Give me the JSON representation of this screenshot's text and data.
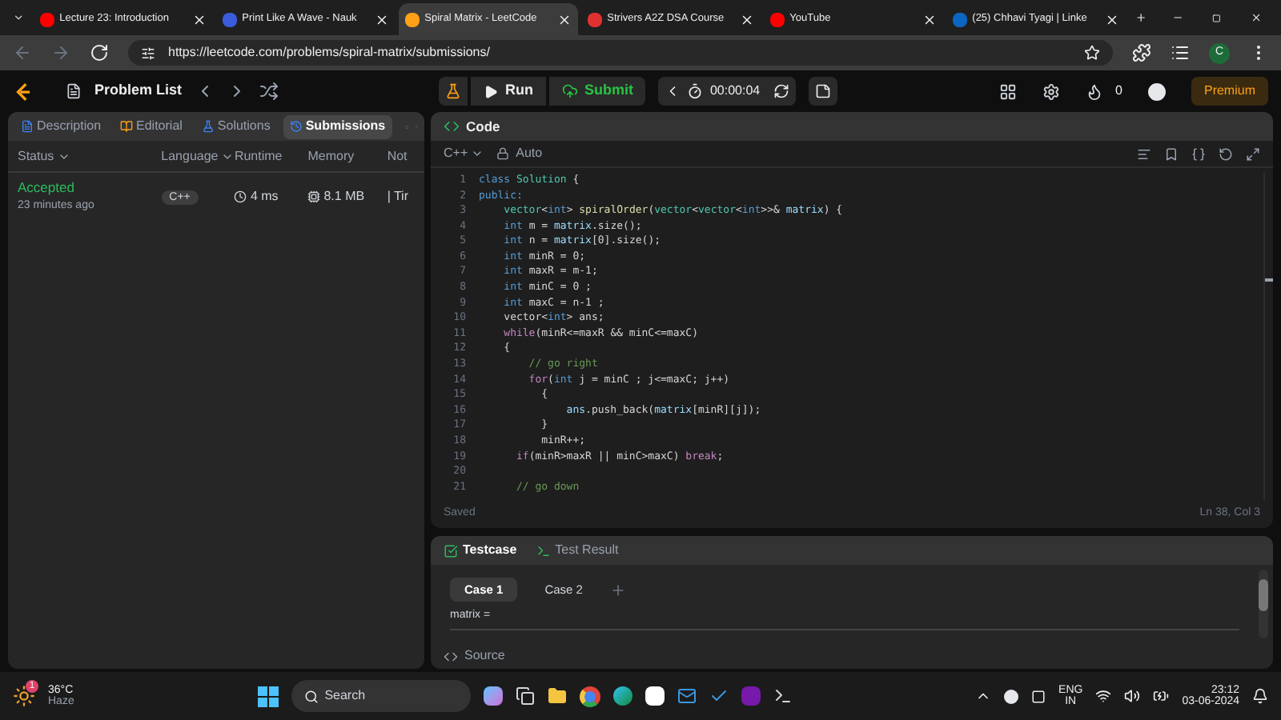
{
  "browser_tabs": [
    {
      "title": "Lecture 23: Introduction",
      "selected": false,
      "kind": "youtube"
    },
    {
      "title": "Print Like A Wave - Nauk",
      "selected": false,
      "kind": "naukri"
    },
    {
      "title": "Spiral Matrix - LeetCode",
      "selected": true,
      "kind": "leetcode"
    },
    {
      "title": "Strivers A2Z DSA Course",
      "selected": false,
      "kind": "tuf"
    },
    {
      "title": "YouTube",
      "selected": false,
      "kind": "youtube"
    },
    {
      "title": "(25) Chhavi Tyagi | Linke",
      "selected": false,
      "kind": "linkedin"
    }
  ],
  "address": "https://leetcode.com/problems/spiral-matrix/submissions/",
  "profile_initial": "C",
  "nav": {
    "problem_list": "Problem List",
    "run": "Run",
    "submit": "Submit",
    "timer": "00:00:04",
    "streak": "0",
    "premium": "Premium"
  },
  "left_tabs": [
    {
      "label": "Description",
      "selected": false
    },
    {
      "label": "Editorial",
      "selected": false
    },
    {
      "label": "Solutions",
      "selected": false
    },
    {
      "label": "Submissions",
      "selected": true
    }
  ],
  "columns": [
    "Status",
    "Language",
    "Runtime",
    "Memory",
    "Not"
  ],
  "submissions": [
    {
      "status": "Accepted",
      "time": "23 minutes ago",
      "language": "C++",
      "runtime": "4 ms",
      "memory": "8.1 MB",
      "column_5": "| Tir"
    }
  ],
  "code_panel": {
    "title": "Code",
    "language": "C++",
    "mode": "Auto",
    "saved": "Saved",
    "cursor": "Ln 38, Col 3"
  },
  "code_lines": [
    {
      "number": "1",
      "tokens": [
        {
          "kind": "keyword",
          "text": "class"
        },
        {
          "kind": "type",
          "text": " Solution"
        },
        {
          "kind": "plain",
          "text": " {"
        }
      ]
    },
    {
      "number": "2",
      "tokens": [
        {
          "kind": "keyword",
          "text": "public:"
        }
      ]
    },
    {
      "number": "3",
      "tokens": [
        {
          "kind": "type",
          "text": "    vector"
        },
        {
          "kind": "plain",
          "text": "<"
        },
        {
          "kind": "keyword",
          "text": "int"
        },
        {
          "kind": "plain",
          "text": "> "
        },
        {
          "kind": "function",
          "text": "spiralOrder"
        },
        {
          "kind": "plain",
          "text": "("
        },
        {
          "kind": "type",
          "text": "vector"
        },
        {
          "kind": "plain",
          "text": "<"
        },
        {
          "kind": "type",
          "text": "vector"
        },
        {
          "kind": "plain",
          "text": "<"
        },
        {
          "kind": "keyword",
          "text": "int"
        },
        {
          "kind": "plain",
          "text": ">>& "
        },
        {
          "kind": "variable",
          "text": "matrix"
        },
        {
          "kind": "plain",
          "text": ") {"
        }
      ]
    },
    {
      "number": "4",
      "tokens": [
        {
          "kind": "keyword",
          "text": "    int"
        },
        {
          "kind": "plain",
          "text": " m = "
        },
        {
          "kind": "variable",
          "text": "matrix"
        },
        {
          "kind": "plain",
          "text": ".size();"
        }
      ]
    },
    {
      "number": "5",
      "tokens": [
        {
          "kind": "keyword",
          "text": "    int"
        },
        {
          "kind": "plain",
          "text": " n = "
        },
        {
          "kind": "variable",
          "text": "matrix"
        },
        {
          "kind": "plain",
          "text": "[0].size();"
        }
      ]
    },
    {
      "number": "6",
      "tokens": [
        {
          "kind": "keyword",
          "text": "    int"
        },
        {
          "kind": "plain",
          "text": " minR = 0;"
        }
      ]
    },
    {
      "number": "7",
      "tokens": [
        {
          "kind": "keyword",
          "text": "    int"
        },
        {
          "kind": "plain",
          "text": " maxR = m-1;"
        }
      ]
    },
    {
      "number": "8",
      "tokens": [
        {
          "kind": "keyword",
          "text": "    int"
        },
        {
          "kind": "plain",
          "text": " minC = 0 ;"
        }
      ]
    },
    {
      "number": "9",
      "tokens": [
        {
          "kind": "keyword",
          "text": "    int"
        },
        {
          "kind": "plain",
          "text": " maxC = n-1 ;"
        }
      ]
    },
    {
      "number": "10",
      "tokens": [
        {
          "kind": "plain",
          "text": "    vector<"
        },
        {
          "kind": "keyword",
          "text": "int"
        },
        {
          "kind": "plain",
          "text": "> ans;"
        }
      ]
    },
    {
      "number": "11",
      "tokens": [
        {
          "kind": "control",
          "text": "    while"
        },
        {
          "kind": "plain",
          "text": "(minR<=maxR && minC<=maxC)"
        }
      ]
    },
    {
      "number": "12",
      "tokens": [
        {
          "kind": "plain",
          "text": "    {"
        }
      ]
    },
    {
      "number": "13",
      "tokens": [
        {
          "kind": "comment",
          "text": "        // go right"
        }
      ]
    },
    {
      "number": "14",
      "tokens": [
        {
          "kind": "control",
          "text": "        for"
        },
        {
          "kind": "plain",
          "text": "("
        },
        {
          "kind": "keyword",
          "text": "int"
        },
        {
          "kind": "plain",
          "text": " j = minC ; j<=maxC; j++)"
        }
      ]
    },
    {
      "number": "15",
      "tokens": [
        {
          "kind": "plain",
          "text": "          {"
        }
      ]
    },
    {
      "number": "16",
      "tokens": [
        {
          "kind": "variable",
          "text": "              ans"
        },
        {
          "kind": "plain",
          "text": ".push_back("
        },
        {
          "kind": "variable",
          "text": "matrix"
        },
        {
          "kind": "plain",
          "text": "[minR][j]);"
        }
      ]
    },
    {
      "number": "17",
      "tokens": [
        {
          "kind": "plain",
          "text": "          }"
        }
      ]
    },
    {
      "number": "18",
      "tokens": [
        {
          "kind": "plain",
          "text": "          minR++;"
        }
      ]
    },
    {
      "number": "19",
      "tokens": [
        {
          "kind": "control",
          "text": "      if"
        },
        {
          "kind": "plain",
          "text": "(minR>maxR || minC>maxC) "
        },
        {
          "kind": "control",
          "text": "break"
        },
        {
          "kind": "plain",
          "text": ";"
        }
      ]
    },
    {
      "number": "20"
    },
    {
      "number": "21",
      "tokens": [
        {
          "kind": "comment",
          "text": "      // go down"
        }
      ]
    }
  ],
  "test_tabs": [
    {
      "label": "Testcase",
      "selected": true
    },
    {
      "label": "Test Result",
      "selected": false
    }
  ],
  "cases": [
    {
      "label": "Case 1",
      "selected": true
    },
    {
      "label": "Case 2",
      "selected": false
    }
  ],
  "param_label": "matrix =",
  "source_label": "Source",
  "taskbar": {
    "temperature": "36°C",
    "weather": "Haze",
    "weather_badge": "1",
    "search": "Search",
    "language": "ENG",
    "region": "IN",
    "time": "23:12",
    "date": "03-06-2024"
  }
}
